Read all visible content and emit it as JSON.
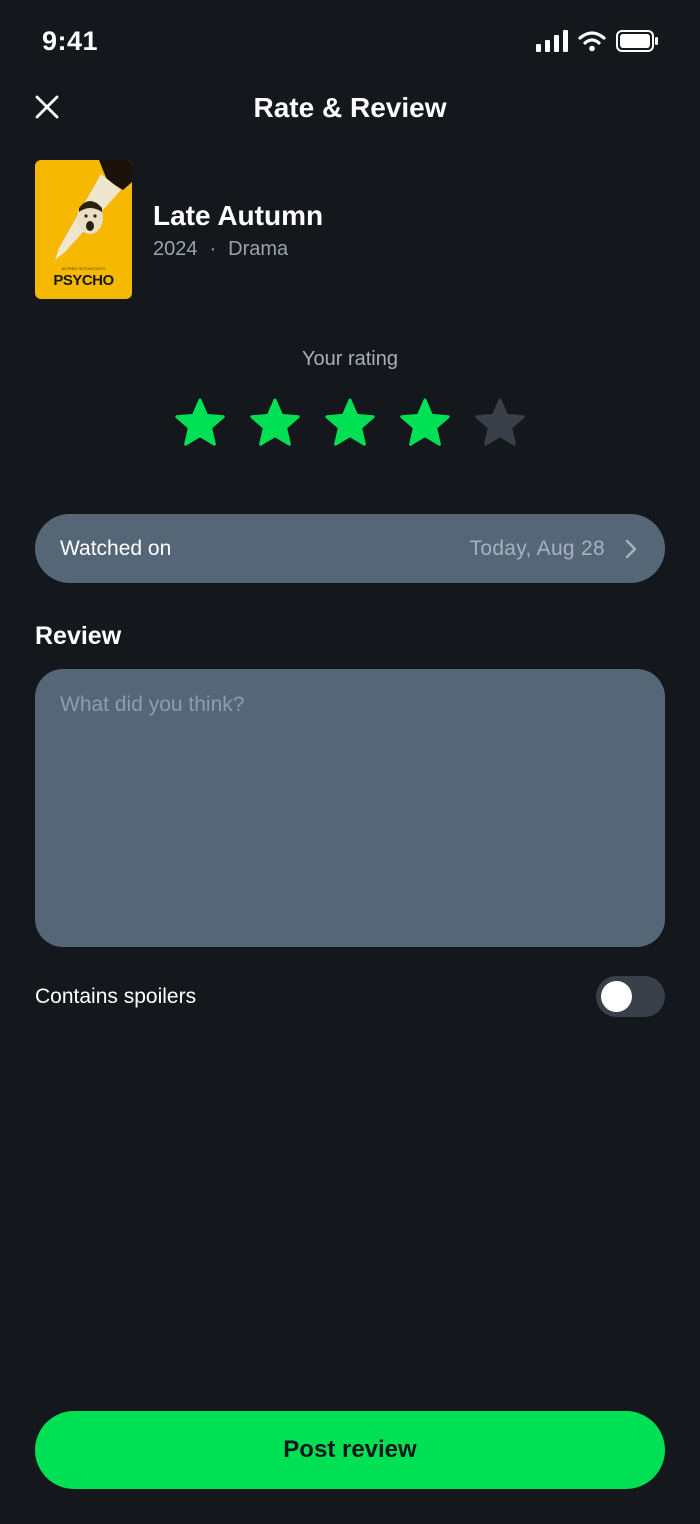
{
  "status_bar": {
    "time": "9:41",
    "icons": [
      "cellular-signal-icon",
      "wifi-icon",
      "battery-icon"
    ]
  },
  "header": {
    "title": "Rate & Review",
    "close_icon": "close-icon"
  },
  "movie": {
    "title": "Late Autumn",
    "year": "2024",
    "separator": "·",
    "genre": "Drama",
    "poster": {
      "title": "PSYCHO",
      "credit": "ALFRED HITCHCOCK'S"
    }
  },
  "rating": {
    "label": "Your rating",
    "value": 4,
    "max": 5
  },
  "watched": {
    "label": "Watched on",
    "value": "Today, Aug 28"
  },
  "review": {
    "label": "Review",
    "placeholder": "What did you think?",
    "value": ""
  },
  "spoilers": {
    "label": "Contains spoilers",
    "enabled": false
  },
  "post_button": {
    "label": "Post review"
  },
  "colors": {
    "background": "#14171c",
    "accent": "#00e054",
    "field": "#556677",
    "star_off": "#3a4049",
    "muted_text": "#9aa3ad"
  }
}
